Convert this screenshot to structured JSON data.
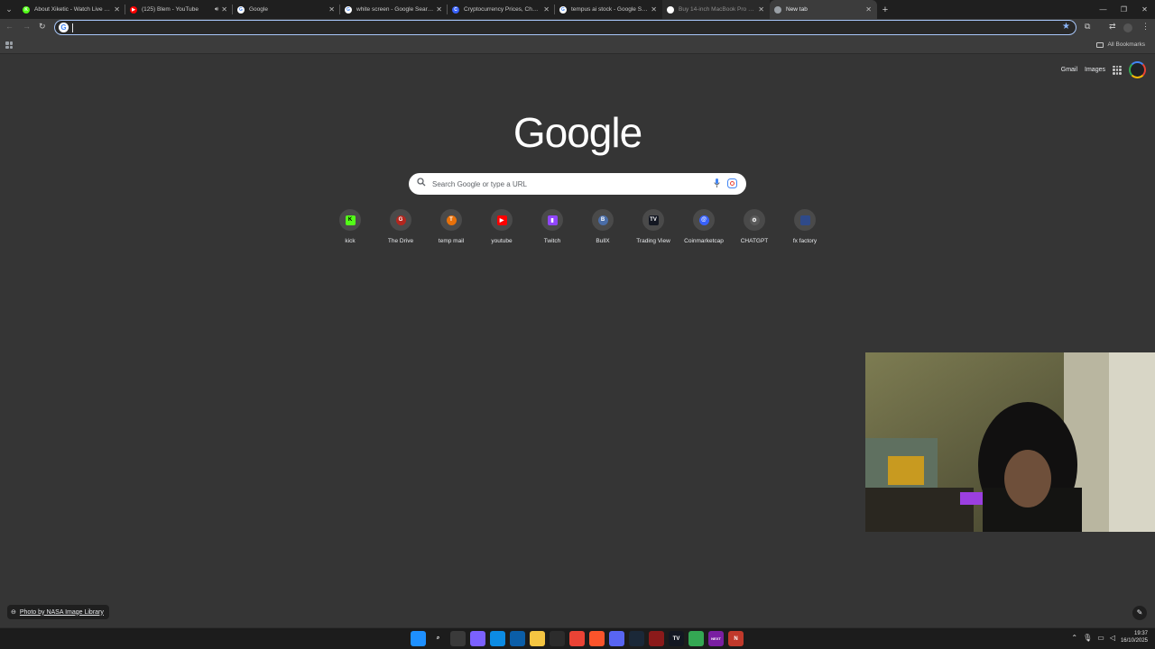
{
  "browser": {
    "tabs": [
      {
        "title": "About Xiketic - Watch Live on K",
        "favicon_color": "#53fc18",
        "favicon_letter": "K"
      },
      {
        "title": "(125) Blem - YouTube",
        "favicon_color": "#ff0000",
        "favicon_letter": "▶",
        "audio": true
      },
      {
        "title": "Google",
        "favicon_color": "#ffffff",
        "favicon_letter": "G"
      },
      {
        "title": "white screen - Google Search",
        "favicon_color": "#ffffff",
        "favicon_letter": "G"
      },
      {
        "title": "Cryptocurrency Prices, Charts &",
        "favicon_color": "#3861fb",
        "favicon_letter": "C"
      },
      {
        "title": "tempus ai stock - Google Search",
        "favicon_color": "#ffffff",
        "favicon_letter": "G"
      },
      {
        "title": "Buy 14-inch MacBook Pro with",
        "favicon_color": "#ffffff",
        "favicon_letter": ""
      },
      {
        "title": "New tab",
        "favicon_color": "#9aa0a6",
        "favicon_letter": ""
      }
    ],
    "omnibox": {
      "value": "",
      "placeholder": ""
    },
    "bookmarks_bar": {
      "all_bookmarks": "All Bookmarks"
    }
  },
  "ntp": {
    "header": {
      "gmail": "Gmail",
      "images": "Images"
    },
    "logo": "Google",
    "search": {
      "placeholder": "Search Google or type a URL"
    },
    "shortcuts": [
      {
        "label": "kick",
        "color": "#53fc18",
        "letter": "K",
        "text_color": "#000000"
      },
      {
        "label": "The Drive",
        "color": "#b3261e",
        "letter": "G",
        "text_color": "#ffffff"
      },
      {
        "label": "temp mail",
        "color": "#e8710a",
        "letter": "T",
        "text_color": "#ffffff"
      },
      {
        "label": "youtube",
        "color": "#ff0000",
        "letter": "▶",
        "text_color": "#ffffff"
      },
      {
        "label": "Twitch",
        "color": "#9146ff",
        "letter": "▮",
        "text_color": "#ffffff"
      },
      {
        "label": "BullX",
        "color": "#4a6da7",
        "letter": "B",
        "text_color": "#ffffff"
      },
      {
        "label": "Trading View",
        "color": "#131722",
        "letter": "TV",
        "text_color": "#ffffff"
      },
      {
        "label": "Coinmarketcap",
        "color": "#3861fb",
        "letter": "@",
        "text_color": "#ffffff"
      },
      {
        "label": "CHATGPT",
        "color": "#5a5a5a",
        "letter": "⚙",
        "text_color": "#ffffff"
      },
      {
        "label": "fx factory",
        "color": "#2f4a8a",
        "letter": "",
        "text_color": "#ffffff"
      }
    ],
    "photo_credit": "Photo by NASA Image Library"
  },
  "taskbar": {
    "apps": [
      {
        "name": "windows-start",
        "color": "#1e90ff",
        "letter": ""
      },
      {
        "name": "search",
        "color": "#1c1c1c",
        "letter": "⌕"
      },
      {
        "name": "task-view",
        "color": "#3a3a3a",
        "letter": ""
      },
      {
        "name": "copilot",
        "color": "#7b61ff",
        "letter": ""
      },
      {
        "name": "edge",
        "color": "#0c8be3",
        "letter": ""
      },
      {
        "name": "store",
        "color": "#0b5ea8",
        "letter": ""
      },
      {
        "name": "file-explorer",
        "color": "#f4c542",
        "letter": ""
      },
      {
        "name": "obs",
        "color": "#2c2c2c",
        "letter": ""
      },
      {
        "name": "chrome",
        "color": "#ea4335",
        "letter": ""
      },
      {
        "name": "brave",
        "color": "#fb542b",
        "letter": ""
      },
      {
        "name": "discord",
        "color": "#5865f2",
        "letter": ""
      },
      {
        "name": "steam",
        "color": "#1b2838",
        "letter": ""
      },
      {
        "name": "app-red",
        "color": "#8b1a1a",
        "letter": ""
      },
      {
        "name": "tradingview",
        "color": "#131722",
        "letter": "TV"
      },
      {
        "name": "chrome-2",
        "color": "#34a853",
        "letter": ""
      },
      {
        "name": "next",
        "color": "#7a1fa2",
        "letter": "NEXT"
      },
      {
        "name": "notion",
        "color": "#c0392b",
        "letter": "N"
      }
    ],
    "time": "19:37",
    "date": "16/10/2025"
  }
}
